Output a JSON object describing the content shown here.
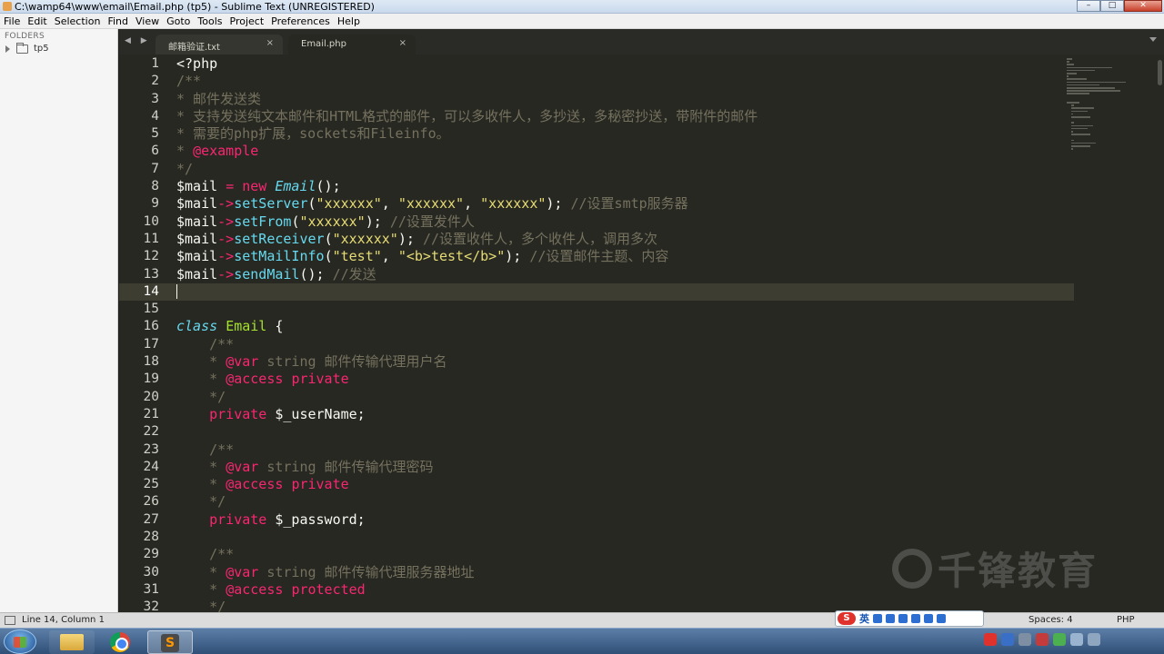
{
  "window": {
    "title": "C:\\wamp64\\www\\email\\Email.php (tp5) - Sublime Text (UNREGISTERED)"
  },
  "menu": [
    "File",
    "Edit",
    "Selection",
    "Find",
    "View",
    "Goto",
    "Tools",
    "Project",
    "Preferences",
    "Help"
  ],
  "sidebar": {
    "heading": "FOLDERS",
    "folder": "tp5"
  },
  "tabs": [
    {
      "label": "邮箱验证.txt",
      "close": "×"
    },
    {
      "label": "Email.php",
      "close": "×"
    }
  ],
  "tabnav": "◀ ▶",
  "editor": {
    "current_line": 14,
    "lines": [
      {
        "n": "1",
        "tokens": [
          [
            "c-plain",
            "<?php"
          ]
        ]
      },
      {
        "n": "2",
        "tokens": [
          [
            "c-cm",
            "/**"
          ]
        ]
      },
      {
        "n": "3",
        "tokens": [
          [
            "c-cm",
            "* 邮件发送类"
          ]
        ]
      },
      {
        "n": "4",
        "tokens": [
          [
            "c-cm",
            "* 支持发送纯文本邮件和HTML格式的邮件，可以多收件人，多抄送，多秘密抄送，带附件的邮件"
          ]
        ]
      },
      {
        "n": "5",
        "tokens": [
          [
            "c-cm",
            "* 需要的php扩展，sockets和Fileinfo。"
          ]
        ]
      },
      {
        "n": "6",
        "tokens": [
          [
            "c-cm",
            "* "
          ],
          [
            "c-kw",
            "@example"
          ]
        ]
      },
      {
        "n": "7",
        "tokens": [
          [
            "c-cm",
            "*/"
          ]
        ]
      },
      {
        "n": "8",
        "tokens": [
          [
            "c-plain",
            "$mail "
          ],
          [
            "c-kw",
            "="
          ],
          [
            "c-plain",
            " "
          ],
          [
            "c-kw",
            "new"
          ],
          [
            "c-plain",
            " "
          ],
          [
            "c-ital",
            "Email"
          ],
          [
            "c-plain",
            "();"
          ]
        ]
      },
      {
        "n": "9",
        "tokens": [
          [
            "c-plain",
            "$mail"
          ],
          [
            "c-kw",
            "->"
          ],
          [
            "c-fn",
            "setServer"
          ],
          [
            "c-plain",
            "("
          ],
          [
            "c-str",
            "\"xxxxxx\""
          ],
          [
            "c-plain",
            ", "
          ],
          [
            "c-str",
            "\"xxxxxx\""
          ],
          [
            "c-plain",
            ", "
          ],
          [
            "c-str",
            "\"xxxxxx\""
          ],
          [
            "c-plain",
            "); "
          ],
          [
            "c-cm",
            "//设置smtp服务器"
          ]
        ]
      },
      {
        "n": "10",
        "tokens": [
          [
            "c-plain",
            "$mail"
          ],
          [
            "c-kw",
            "->"
          ],
          [
            "c-fn",
            "setFrom"
          ],
          [
            "c-plain",
            "("
          ],
          [
            "c-str",
            "\"xxxxxx\""
          ],
          [
            "c-plain",
            "); "
          ],
          [
            "c-cm",
            "//设置发件人"
          ]
        ]
      },
      {
        "n": "11",
        "tokens": [
          [
            "c-plain",
            "$mail"
          ],
          [
            "c-kw",
            "->"
          ],
          [
            "c-fn",
            "setReceiver"
          ],
          [
            "c-plain",
            "("
          ],
          [
            "c-str",
            "\"xxxxxx\""
          ],
          [
            "c-plain",
            "); "
          ],
          [
            "c-cm",
            "//设置收件人，多个收件人，调用多次"
          ]
        ]
      },
      {
        "n": "12",
        "tokens": [
          [
            "c-plain",
            "$mail"
          ],
          [
            "c-kw",
            "->"
          ],
          [
            "c-fn",
            "setMailInfo"
          ],
          [
            "c-plain",
            "("
          ],
          [
            "c-str",
            "\"test\""
          ],
          [
            "c-plain",
            ", "
          ],
          [
            "c-str",
            "\"<b>test</b>\""
          ],
          [
            "c-plain",
            "); "
          ],
          [
            "c-cm",
            "//设置邮件主题、内容"
          ]
        ]
      },
      {
        "n": "13",
        "tokens": [
          [
            "c-plain",
            "$mail"
          ],
          [
            "c-kw",
            "->"
          ],
          [
            "c-fn",
            "sendMail"
          ],
          [
            "c-plain",
            "(); "
          ],
          [
            "c-cm",
            "//发送"
          ]
        ]
      },
      {
        "n": "14",
        "tokens": []
      },
      {
        "n": "15",
        "tokens": []
      },
      {
        "n": "16",
        "tokens": [
          [
            "c-st",
            "class"
          ],
          [
            "c-plain",
            " "
          ],
          [
            "c-cls",
            "Email"
          ],
          [
            "c-plain",
            " {"
          ]
        ]
      },
      {
        "n": "17",
        "tokens": [
          [
            "c-plain",
            "    "
          ],
          [
            "c-cm",
            "/**"
          ]
        ]
      },
      {
        "n": "18",
        "tokens": [
          [
            "c-plain",
            "    "
          ],
          [
            "c-cm",
            "* "
          ],
          [
            "c-kw",
            "@var"
          ],
          [
            "c-cm",
            " string 邮件传输代理用户名"
          ]
        ]
      },
      {
        "n": "19",
        "tokens": [
          [
            "c-plain",
            "    "
          ],
          [
            "c-cm",
            "* "
          ],
          [
            "c-kw",
            "@access"
          ],
          [
            "c-plain",
            " "
          ],
          [
            "c-kw",
            "private"
          ]
        ]
      },
      {
        "n": "20",
        "tokens": [
          [
            "c-plain",
            "    "
          ],
          [
            "c-cm",
            "*/"
          ]
        ]
      },
      {
        "n": "21",
        "tokens": [
          [
            "c-plain",
            "    "
          ],
          [
            "c-kw",
            "private"
          ],
          [
            "c-plain",
            " $_userName;"
          ]
        ]
      },
      {
        "n": "22",
        "tokens": []
      },
      {
        "n": "23",
        "tokens": [
          [
            "c-plain",
            "    "
          ],
          [
            "c-cm",
            "/**"
          ]
        ]
      },
      {
        "n": "24",
        "tokens": [
          [
            "c-plain",
            "    "
          ],
          [
            "c-cm",
            "* "
          ],
          [
            "c-kw",
            "@var"
          ],
          [
            "c-cm",
            " string 邮件传输代理密码"
          ]
        ]
      },
      {
        "n": "25",
        "tokens": [
          [
            "c-plain",
            "    "
          ],
          [
            "c-cm",
            "* "
          ],
          [
            "c-kw",
            "@access"
          ],
          [
            "c-plain",
            " "
          ],
          [
            "c-kw",
            "private"
          ]
        ]
      },
      {
        "n": "26",
        "tokens": [
          [
            "c-plain",
            "    "
          ],
          [
            "c-cm",
            "*/"
          ]
        ]
      },
      {
        "n": "27",
        "tokens": [
          [
            "c-plain",
            "    "
          ],
          [
            "c-kw",
            "private"
          ],
          [
            "c-plain",
            " $_password;"
          ]
        ]
      },
      {
        "n": "28",
        "tokens": []
      },
      {
        "n": "29",
        "tokens": [
          [
            "c-plain",
            "    "
          ],
          [
            "c-cm",
            "/**"
          ]
        ]
      },
      {
        "n": "30",
        "tokens": [
          [
            "c-plain",
            "    "
          ],
          [
            "c-cm",
            "* "
          ],
          [
            "c-kw",
            "@var"
          ],
          [
            "c-cm",
            " string 邮件传输代理服务器地址"
          ]
        ]
      },
      {
        "n": "31",
        "tokens": [
          [
            "c-plain",
            "    "
          ],
          [
            "c-cm",
            "* "
          ],
          [
            "c-kw",
            "@access"
          ],
          [
            "c-plain",
            " "
          ],
          [
            "c-kw",
            "protected"
          ]
        ]
      },
      {
        "n": "32",
        "tokens": [
          [
            "c-plain",
            "    "
          ],
          [
            "c-cm",
            "*/"
          ]
        ]
      }
    ]
  },
  "watermark": "千锋教育",
  "status": {
    "position": "Line 14, Column 1",
    "spaces": "Spaces: 4",
    "syntax": "PHP",
    "ime_label": "英"
  },
  "colors": {
    "editor_bg": "#272822",
    "comment": "#75715e",
    "string": "#e6db74",
    "keyword": "#f92672",
    "function": "#66d9ef",
    "class": "#a6e22e"
  }
}
